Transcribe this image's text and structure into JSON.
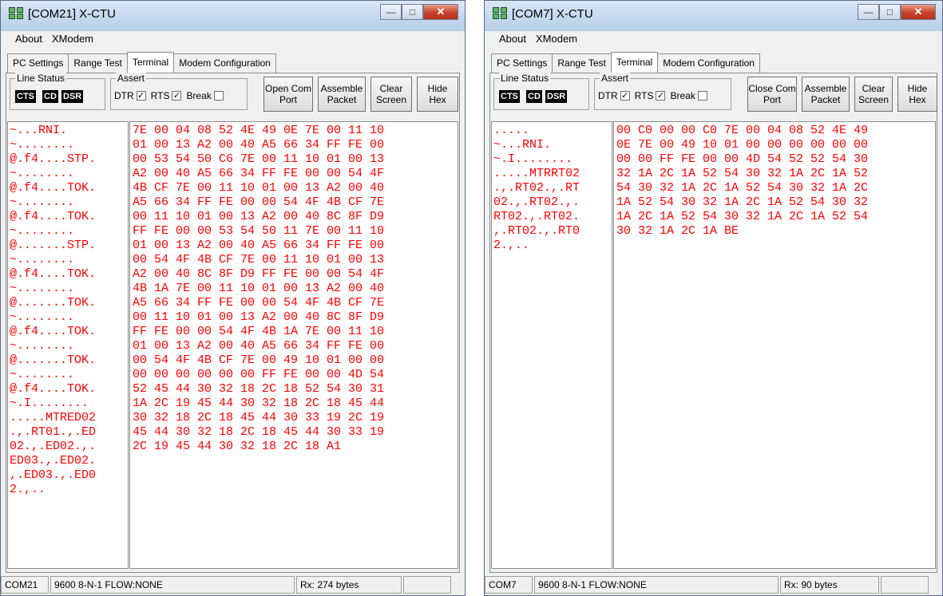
{
  "windows": [
    {
      "title": "[COM21] X-CTU",
      "menu": [
        "About",
        "XModem"
      ],
      "tabs": [
        "PC Settings",
        "Range Test",
        "Terminal",
        "Modem Configuration"
      ],
      "active_tab": 2,
      "line_status": {
        "label": "Line Status",
        "indicators": [
          "CTS",
          "CD",
          "DSR"
        ]
      },
      "assert": {
        "label": "Assert",
        "items": [
          {
            "label": "DTR",
            "checked": true
          },
          {
            "label": "RTS",
            "checked": true
          },
          {
            "label": "Break",
            "checked": false
          }
        ]
      },
      "buttons": {
        "com_port": "Open Com Port",
        "assemble": "Assemble Packet",
        "clear": "Clear Screen",
        "hide_hex": "Hide Hex"
      },
      "ascii_lines": [
        "~...RNI.",
        "~........",
        "@.f4....STP.",
        "~........",
        "@.f4....TOK.",
        "~........",
        "@.f4....TOK.",
        "~........",
        "@.......STP.",
        "~........",
        "@.f4....TOK.",
        "~........",
        "@.......TOK.",
        "~........",
        "@.f4....TOK.",
        "~........",
        "@.......TOK.",
        "~........",
        "@.f4....TOK.",
        "~.I........",
        ".....MTRED02",
        ".,.RT01.,.ED",
        "02.,.ED02.,.",
        "ED03.,.ED02.",
        ",.ED03.,.ED0",
        "2.,.."
      ],
      "hex_lines": [
        "7E 00 04 08 52 4E 49 0E 7E 00 11 10",
        "01 00 13 A2 00 40 A5 66 34 FF FE 00",
        "00 53 54 50 C6 7E 00 11 10 01 00 13",
        "A2 00 40 A5 66 34 FF FE 00 00 54 4F",
        "4B CF 7E 00 11 10 01 00 13 A2 00 40",
        "A5 66 34 FF FE 00 00 54 4F 4B CF 7E",
        "00 11 10 01 00 13 A2 00 40 8C 8F D9",
        "FF FE 00 00 53 54 50 11 7E 00 11 10",
        "01 00 13 A2 00 40 A5 66 34 FF FE 00",
        "00 54 4F 4B CF 7E 00 11 10 01 00 13",
        "A2 00 40 8C 8F D9 FF FE 00 00 54 4F",
        "4B 1A 7E 00 11 10 01 00 13 A2 00 40",
        "A5 66 34 FF FE 00 00 54 4F 4B CF 7E",
        "00 11 10 01 00 13 A2 00 40 8C 8F D9",
        "FF FE 00 00 54 4F 4B 1A 7E 00 11 10",
        "01 00 13 A2 00 40 A5 66 34 FF FE 00",
        "00 54 4F 4B CF 7E 00 49 10 01 00 00",
        "00 00 00 00 00 00 FF FE 00 00 4D 54",
        "52 45 44 30 32 18 2C 18 52 54 30 31",
        "1A 2C 19 45 44 30 32 18 2C 18 45 44",
        "30 32 18 2C 18 45 44 30 33 19 2C 19",
        "45 44 30 32 18 2C 18 45 44 30 33 19",
        "2C 19 45 44 30 32 18 2C 18 A1"
      ],
      "status": {
        "port": "COM21",
        "settings": "9600 8-N-1  FLOW:NONE",
        "rx": "Rx: 274 bytes"
      }
    },
    {
      "title": "[COM7] X-CTU",
      "menu": [
        "About",
        "XModem"
      ],
      "tabs": [
        "PC Settings",
        "Range Test",
        "Terminal",
        "Modem Configuration"
      ],
      "active_tab": 2,
      "line_status": {
        "label": "Line Status",
        "indicators": [
          "CTS",
          "CD",
          "DSR"
        ]
      },
      "assert": {
        "label": "Assert",
        "items": [
          {
            "label": "DTR",
            "checked": true
          },
          {
            "label": "RTS",
            "checked": true
          },
          {
            "label": "Break",
            "checked": false
          }
        ]
      },
      "buttons": {
        "com_port": "Close Com Port",
        "assemble": "Assemble Packet",
        "clear": "Clear Screen",
        "hide_hex": "Hide Hex"
      },
      "ascii_lines": [
        ".....",
        "~...RNI.",
        "~.I........",
        ".....MTRRT02",
        ".,.RT02.,.RT",
        "02.,.RT02.,.",
        "RT02.,.RT02.",
        ",.RT02.,.RT0",
        "2.,.."
      ],
      "hex_lines": [
        "00 C0 00 00 C0 7E 00 04 08 52 4E 49",
        "0E 7E 00 49 10 01 00 00 00 00 00 00",
        "00 00 FF FE 00 00 4D 54 52 52 54 30",
        "32 1A 2C 1A 52 54 30 32 1A 2C 1A 52",
        "54 30 32 1A 2C 1A 52 54 30 32 1A 2C",
        "1A 52 54 30 32 1A 2C 1A 52 54 30 32",
        "1A 2C 1A 52 54 30 32 1A 2C 1A 52 54",
        "30 32 1A 2C 1A BE"
      ],
      "status": {
        "port": "COM7",
        "settings": "9600 8-N-1  FLOW:NONE",
        "rx": "Rx: 90 bytes"
      }
    }
  ]
}
